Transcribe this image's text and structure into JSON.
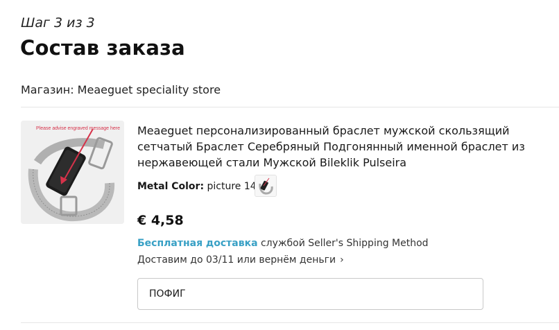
{
  "header": {
    "step": "Шаг 3 из 3",
    "title": "Состав заказа"
  },
  "store": {
    "label": "Магазин: Meaeguet speciality store"
  },
  "item": {
    "image_caption": "Please advise engraved message here",
    "name": "Meaeguet персонализированный браслет мужской скользящий сетчатый Браслет Серебряный Подгонянный именной браслет из нержавеющей стали Мужской Bileklik Pulseira",
    "variant_label": "Metal Color:",
    "variant_value": "picture 14",
    "price": "€ 4,58",
    "shipping_free": "Бесплатная доставка",
    "shipping_method": "службой Seller's Shipping Method",
    "delivery": "Доставим до 03/11 или вернём деньги",
    "comment_value": "ПОФИГ"
  },
  "colors": {
    "accent_link": "#38a0c5",
    "arrow": "#d6324a"
  }
}
